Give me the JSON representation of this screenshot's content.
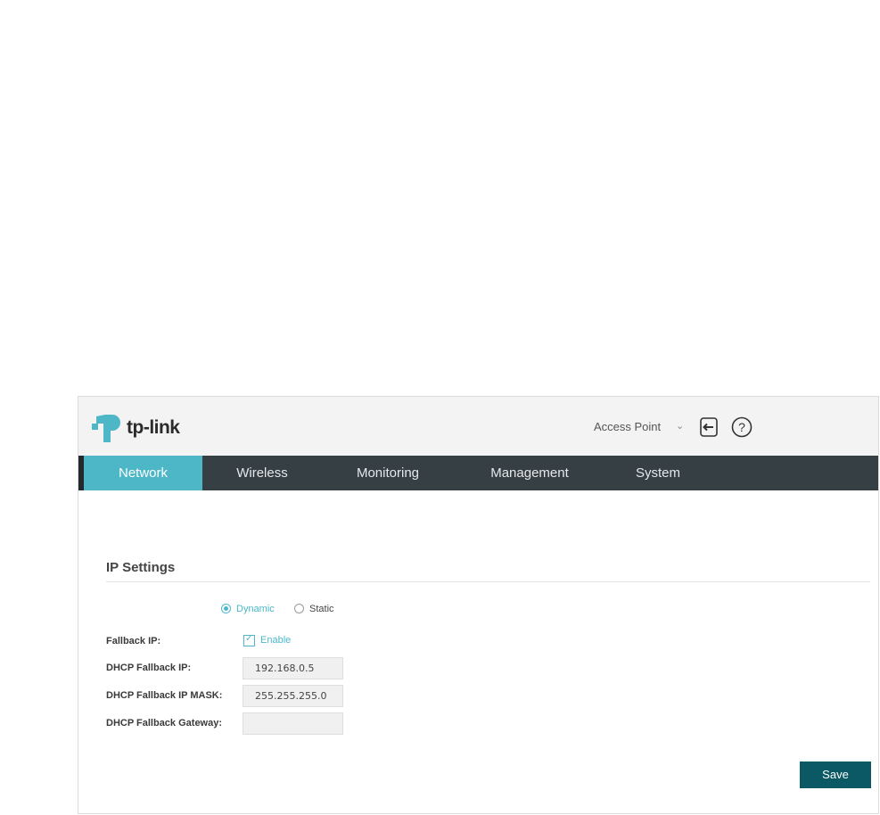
{
  "header": {
    "logo_text": "tp-link",
    "mode_select": {
      "value": "Access Point"
    },
    "icons": [
      "logout-icon",
      "help-icon"
    ]
  },
  "nav": {
    "tabs": [
      {
        "label": "Network",
        "active": true
      },
      {
        "label": "Wireless",
        "active": false
      },
      {
        "label": "Monitoring",
        "active": false
      },
      {
        "label": "Management",
        "active": false
      },
      {
        "label": "System",
        "active": false
      }
    ]
  },
  "ip_settings": {
    "title": "IP Settings",
    "mode_options": [
      {
        "label": "Dynamic",
        "checked": true
      },
      {
        "label": "Static",
        "checked": false
      }
    ],
    "fallback_ip": {
      "label": "Fallback IP:",
      "checkbox_label": "Enable",
      "checked": true
    },
    "dhcp_fallback_ip": {
      "label": "DHCP Fallback IP:",
      "value": "192.168.0.5"
    },
    "dhcp_fallback_mask": {
      "label": "DHCP Fallback IP MASK:",
      "value": "255.255.255.0"
    },
    "dhcp_fallback_gateway": {
      "label": "DHCP Fallback Gateway:",
      "value": ""
    },
    "save_label": "Save"
  },
  "colors": {
    "accent": "#4db7c8",
    "nav_bg": "#353f44",
    "save_bg": "#0b5965",
    "header_bg": "#f3f3f3"
  }
}
